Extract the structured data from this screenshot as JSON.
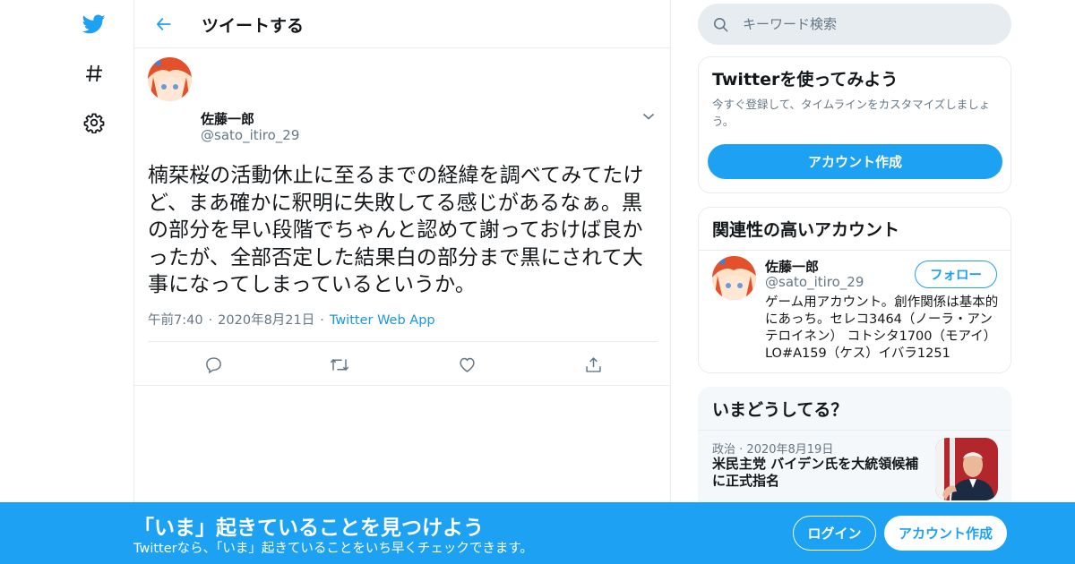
{
  "colors": {
    "accent": "#1da1f2",
    "text": "#14171a",
    "muted": "#657786",
    "border": "#e6ecf0"
  },
  "nav": {
    "items": [
      {
        "name": "twitter-logo-icon"
      },
      {
        "name": "explore-hashtag-icon"
      },
      {
        "name": "settings-gear-icon"
      }
    ]
  },
  "header": {
    "title": "ツイートする"
  },
  "tweet": {
    "author_name": "佐藤一郎",
    "author_handle": "@sato_itiro_29",
    "text": "楠栞桜の活動休止に至るまでの経緯を調べてみてたけど、まあ確かに釈明に失敗してる感じがあるなぁ。黒の部分を早い段階でちゃんと認めて謝っておけば良かったが、全部否定した結果白の部分まで黒にされて大事になってしまっているというか。",
    "time": "午前7:40",
    "date": "2020年8月21日",
    "source": "Twitter Web App"
  },
  "search": {
    "placeholder": "キーワード検索"
  },
  "signup_card": {
    "title": "Twitterを使ってみよう",
    "description": "今すぐ登録して、タイムラインをカスタマイズしましょう。",
    "button": "アカウント作成"
  },
  "related": {
    "title": "関連性の高いアカウント",
    "name": "佐藤一郎",
    "handle": "@sato_itiro_29",
    "follow": "フォロー",
    "bio": "ゲーム用アカウント。創作関係は基本的にあっち。セレコ3464（ノーラ・アンテロイネン） コトシタ1700（モアイ） LO#A159（ケス）イバラ1251"
  },
  "trends": {
    "title": "いまどうしてる？",
    "category": "政治",
    "date": "2020年8月19日",
    "headline": "米民主党 バイデン氏を大統領候補に正式指名"
  },
  "banner": {
    "title": "「いま」起きていることを見つけよう",
    "subtitle": "Twitterなら、「いま」起きていることをいち早くチェックできます。",
    "login": "ログイン",
    "signup": "アカウント作成"
  }
}
